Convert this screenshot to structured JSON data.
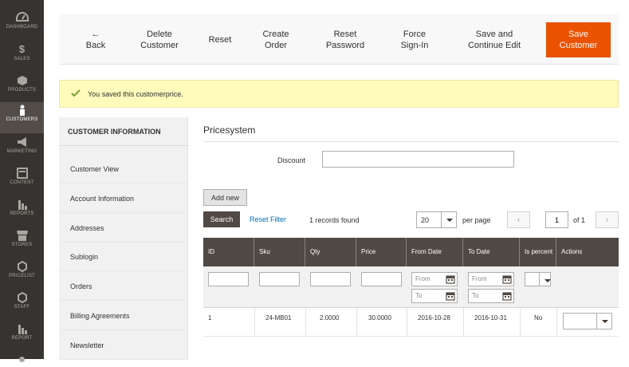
{
  "sidebar": {
    "items": [
      {
        "label": "DASHBOARD",
        "icon": "dashboard-icon"
      },
      {
        "label": "SALES",
        "icon": "dollar-icon"
      },
      {
        "label": "PRODUCTS",
        "icon": "box-icon"
      },
      {
        "label": "CUSTOMERS",
        "icon": "person-icon",
        "active": true
      },
      {
        "label": "MARKETING",
        "icon": "megaphone-icon"
      },
      {
        "label": "CONTENT",
        "icon": "layout-icon"
      },
      {
        "label": "REPORTS",
        "icon": "bar-chart-icon"
      },
      {
        "label": "STORES",
        "icon": "store-icon"
      },
      {
        "label": "PRICELIST",
        "icon": "hexagon-icon"
      },
      {
        "label": "STAFF",
        "icon": "hexagon-icon"
      },
      {
        "label": "REPORT",
        "icon": "bar-chart-icon"
      }
    ]
  },
  "toolbar": {
    "back_arrow": "←",
    "back_label": "Back",
    "delete_line1": "Delete",
    "delete_line2": "Customer",
    "reset_label": "Reset",
    "create_order_line1": "Create",
    "create_order_line2": "Order",
    "reset_password_line1": "Reset",
    "reset_password_line2": "Password",
    "force_signin_line1": "Force",
    "force_signin_line2": "Sign-In",
    "save_continue_line1": "Save and",
    "save_continue_line2": "Continue Edit",
    "save_line1": "Save",
    "save_line2": "Customer"
  },
  "message": {
    "text": "You saved this customerprice."
  },
  "left_nav": {
    "title": "CUSTOMER INFORMATION",
    "items": [
      "Customer View",
      "Account Information",
      "Addresses",
      "Sublogin",
      "Orders",
      "Billing Agreements",
      "Newsletter"
    ]
  },
  "main": {
    "section_title": "Pricesystem",
    "discount_label": "Discount",
    "discount_value": "",
    "add_new_label": "Add new",
    "search_label": "Search",
    "reset_filter_label": "Reset Filter",
    "records_found": "1 records found",
    "per_page_value": "20",
    "per_page_label": "per page",
    "page_value": "1",
    "page_of": "of 1",
    "prev_glyph": "‹",
    "next_glyph": "›"
  },
  "grid": {
    "columns": [
      "ID",
      "Sku",
      "Qty",
      "Price",
      "From Date",
      "To Date",
      "Is percent",
      "Actions"
    ],
    "filter_from_placeholder": "From",
    "filter_to_placeholder": "To",
    "rows": [
      {
        "id": "1",
        "sku": "24-MB01",
        "qty": "2.0000",
        "price": "30.0000",
        "from_date": "2016-10-28",
        "to_date": "2016-10-31",
        "is_percent": "No"
      }
    ]
  },
  "colors": {
    "accent": "#eb5202",
    "sidebar": "#373330",
    "grid_header": "#514943",
    "message_bg": "#fffbbb"
  }
}
